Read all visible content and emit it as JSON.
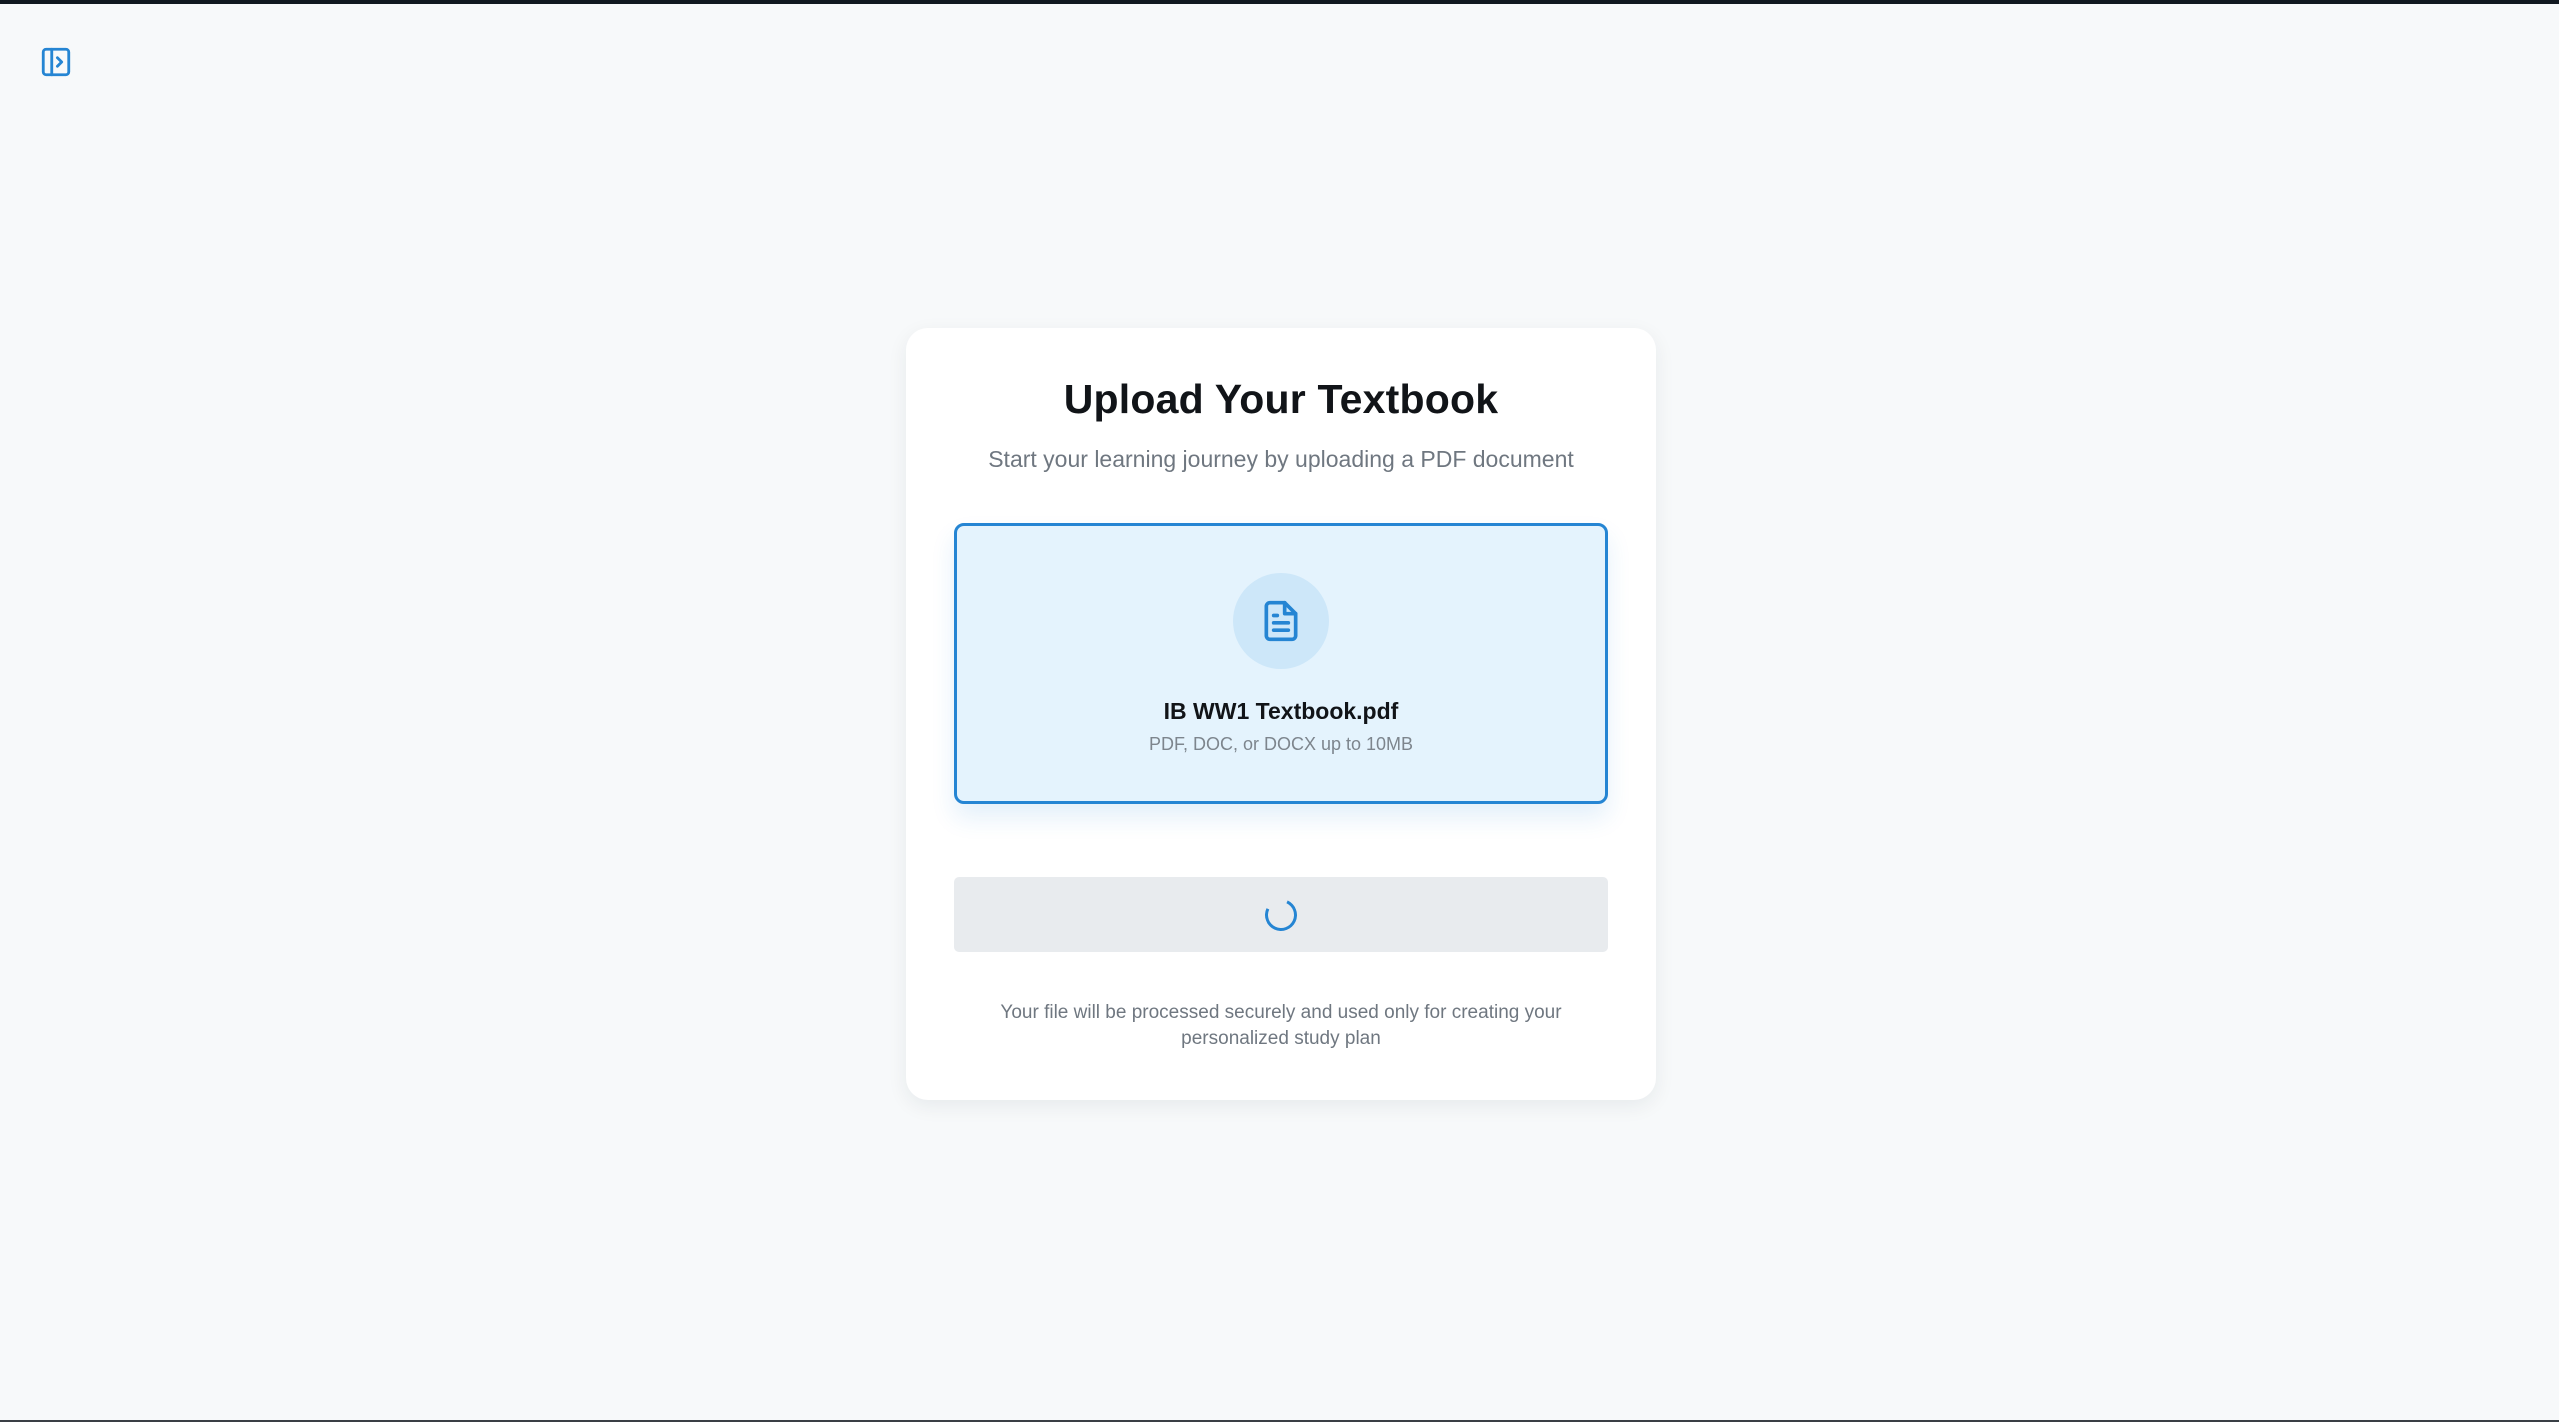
{
  "sidebar": {
    "toggle_icon": "sidebar-expand-icon"
  },
  "upload_card": {
    "title": "Upload Your Textbook",
    "subtitle": "Start your learning journey by uploading a PDF document",
    "dropzone": {
      "file_icon": "document-icon",
      "file_name": "IB WW1 Textbook.pdf",
      "hint": "PDF, DOC, or DOCX up to 10MB"
    },
    "submit": {
      "state": "loading",
      "icon": "spinner-icon"
    },
    "footnote": "Your file will be processed securely and used only for creating your personalized study plan"
  },
  "colors": {
    "accent": "#2585d3",
    "dropzone_bg": "#e4f3fd",
    "page_bg": "#f7f9fa",
    "button_disabled_bg": "#e8ebee"
  }
}
